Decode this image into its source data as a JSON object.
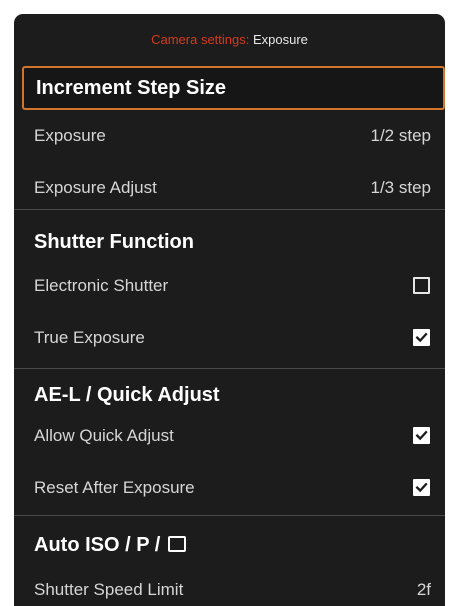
{
  "header": {
    "prefix": "Camera settings:",
    "title": "Exposure"
  },
  "sections": {
    "increment": {
      "title": "Increment Step Size",
      "rows": [
        {
          "label": "Exposure",
          "value": "1/2 step"
        },
        {
          "label": "Exposure Adjust",
          "value": "1/3 step"
        }
      ]
    },
    "shutter": {
      "title": "Shutter Function",
      "rows": [
        {
          "label": "Electronic Shutter",
          "checked": false
        },
        {
          "label": "True Exposure",
          "checked": true
        }
      ]
    },
    "ael": {
      "title": "AE-L / Quick Adjust",
      "rows": [
        {
          "label": "Allow Quick Adjust",
          "checked": true
        },
        {
          "label": "Reset After Exposure",
          "checked": true
        }
      ]
    },
    "autoiso": {
      "title": "Auto ISO / P /",
      "title_icon": "aperture-mode-square-icon",
      "rows": [
        {
          "label": "Shutter Speed Limit",
          "value": "2f"
        }
      ]
    }
  },
  "colors": {
    "background": "#1c1c1c",
    "accent_prefix": "#d43a1e",
    "selection_border": "#d2752c",
    "divider": "#4a4a4a"
  }
}
